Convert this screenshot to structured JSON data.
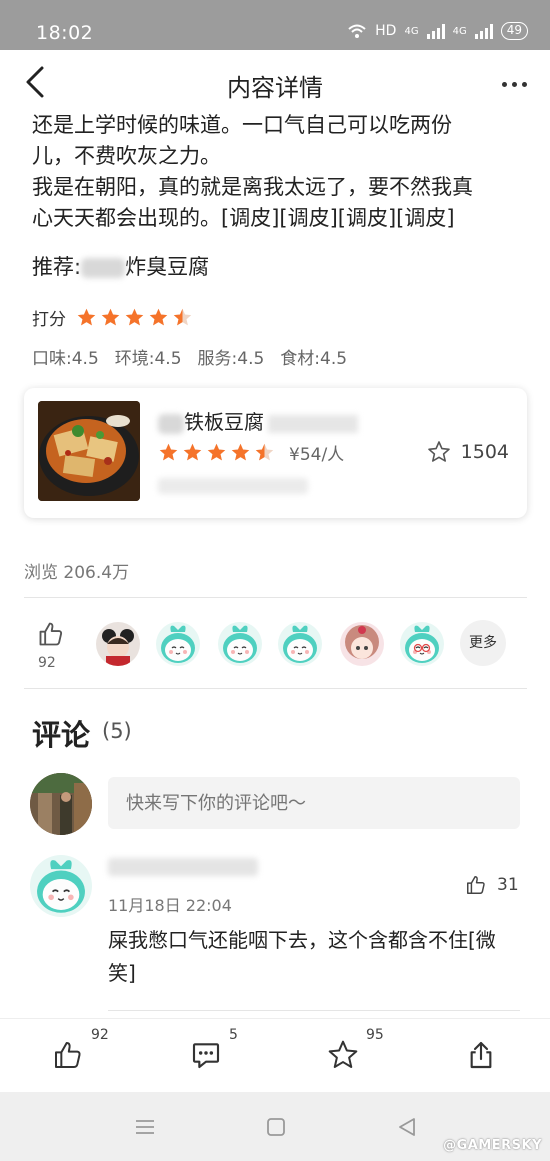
{
  "status_bar": {
    "time": "18:02",
    "network": "HD",
    "signal1": "4G",
    "signal2": "4G",
    "battery": "49"
  },
  "nav": {
    "title": "内容详情"
  },
  "review": {
    "lines": [
      "还是上学时候的味道。一口气自己可以吃两份",
      "儿，不费吹灰之力。",
      "我是在朝阳，真的就是离我太远了，要不然我真",
      "心天天都会出现的。[调皮][调皮][调皮][调皮]"
    ],
    "recommend_label": "推荐:",
    "recommend_dish": "炸臭豆腐",
    "score_label": "打分",
    "score": 4.5,
    "sub_scores": [
      "口味:4.5",
      "环境:4.5",
      "服务:4.5",
      "食材:4.5"
    ]
  },
  "shop": {
    "name": "铁板豆腐",
    "rating": 4.5,
    "price": "¥54/人",
    "favorites": "1504"
  },
  "views": "浏览 206.4万",
  "likes": {
    "count": "92",
    "more_label": "更多"
  },
  "comments": {
    "title": "评论",
    "count": "(5)",
    "input_placeholder": "快来写下你的评论吧～",
    "items": [
      {
        "time": "11月18日  22:04",
        "likes": "31",
        "text": "屎我憋口气还能咽下去，这个含都含不住[微笑]"
      }
    ]
  },
  "actions": {
    "like_count": "92",
    "comment_count": "5",
    "favorite_count": "95"
  },
  "watermark": "@GAMERSKY",
  "colors": {
    "star": "#f5732a",
    "status_bar": "#9c9c9c",
    "mascot": "#4fd0c0"
  }
}
